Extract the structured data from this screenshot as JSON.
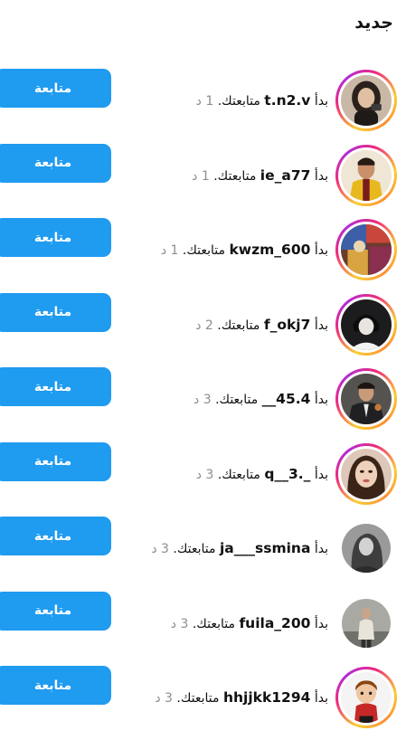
{
  "section_title": "جديد",
  "colors": {
    "follow_button": "#1f9bf0",
    "follow_text": "#ffffff",
    "time_text": "#8e8e8e"
  },
  "rows": [
    {
      "prefix": "بدأ",
      "username": "t.n2.v",
      "message": "متابعتك.",
      "time": "1 د",
      "button": "متابعة",
      "has_story_ring": true,
      "avatar": "avatar-woman-dark-hair"
    },
    {
      "prefix": "بدأ",
      "username": "ie_a77",
      "message": "متابعتك.",
      "time": "1 د",
      "button": "متابعة",
      "has_story_ring": true,
      "avatar": "avatar-man-yellow-jacket"
    },
    {
      "prefix": "بدأ",
      "username": "kwzm_600",
      "message": "متابعتك.",
      "time": "1 د",
      "button": "متابعة",
      "has_story_ring": true,
      "avatar": "avatar-colorful-fabrics"
    },
    {
      "prefix": "بدأ",
      "username": "f_okj7",
      "message": "متابعتك.",
      "time": "2 د",
      "button": "متابعة",
      "has_story_ring": true,
      "avatar": "avatar-anime-dark"
    },
    {
      "prefix": "بدأ",
      "username": "__45.4",
      "message": "متابعتك.",
      "time": "3 د",
      "button": "متابعة",
      "has_story_ring": true,
      "avatar": "avatar-man-suit"
    },
    {
      "prefix": "بدأ",
      "username": "q__3._",
      "message": "متابعتك.",
      "time": "3 د",
      "button": "متابعة",
      "has_story_ring": true,
      "avatar": "avatar-woman-makeup"
    },
    {
      "prefix": "بدأ",
      "username": "ja___ssmina",
      "message": "متابعتك.",
      "time": "3 د",
      "button": "متابعة",
      "has_story_ring": false,
      "avatar": "avatar-grayscale-person"
    },
    {
      "prefix": "بدأ",
      "username": "fuila_200",
      "message": "متابعتك.",
      "time": "3 د",
      "button": "متابعة",
      "has_story_ring": false,
      "avatar": "avatar-person-street"
    },
    {
      "prefix": "بدأ",
      "username": "hhjjkk1294",
      "message": "متابعتك.",
      "time": "3 د",
      "button": "متابعة",
      "has_story_ring": true,
      "avatar": "avatar-cartoon-boy"
    }
  ]
}
